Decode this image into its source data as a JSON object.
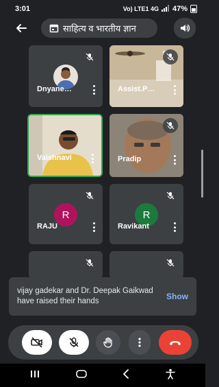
{
  "status_bar": {
    "time": "3:01",
    "network": "Vo) LTE1 4G",
    "battery": "47%"
  },
  "top_bar": {
    "title": "साहित्य व भारतीय ज्ञान"
  },
  "participants": [
    {
      "name": "Dnyane…",
      "muted": true
    },
    {
      "name": "Assist.P…",
      "muted": true
    },
    {
      "name": "Vaishnavi",
      "muted": false
    },
    {
      "name": "Pradip",
      "muted": true
    },
    {
      "name": "RAJU",
      "initial": "R",
      "avatar_color": "#b0135c",
      "muted": true
    },
    {
      "name": "Ravikant",
      "initial": "R",
      "avatar_color": "#1b7a3d",
      "muted": true
    }
  ],
  "notification": {
    "text": "vijay gadekar and Dr. Deepak Gaikwad have raised their hands",
    "action": "Show"
  },
  "colors": {
    "accent": "#8ab4f8",
    "end_call": "#ea4335",
    "active_speaker": "#34a853"
  }
}
